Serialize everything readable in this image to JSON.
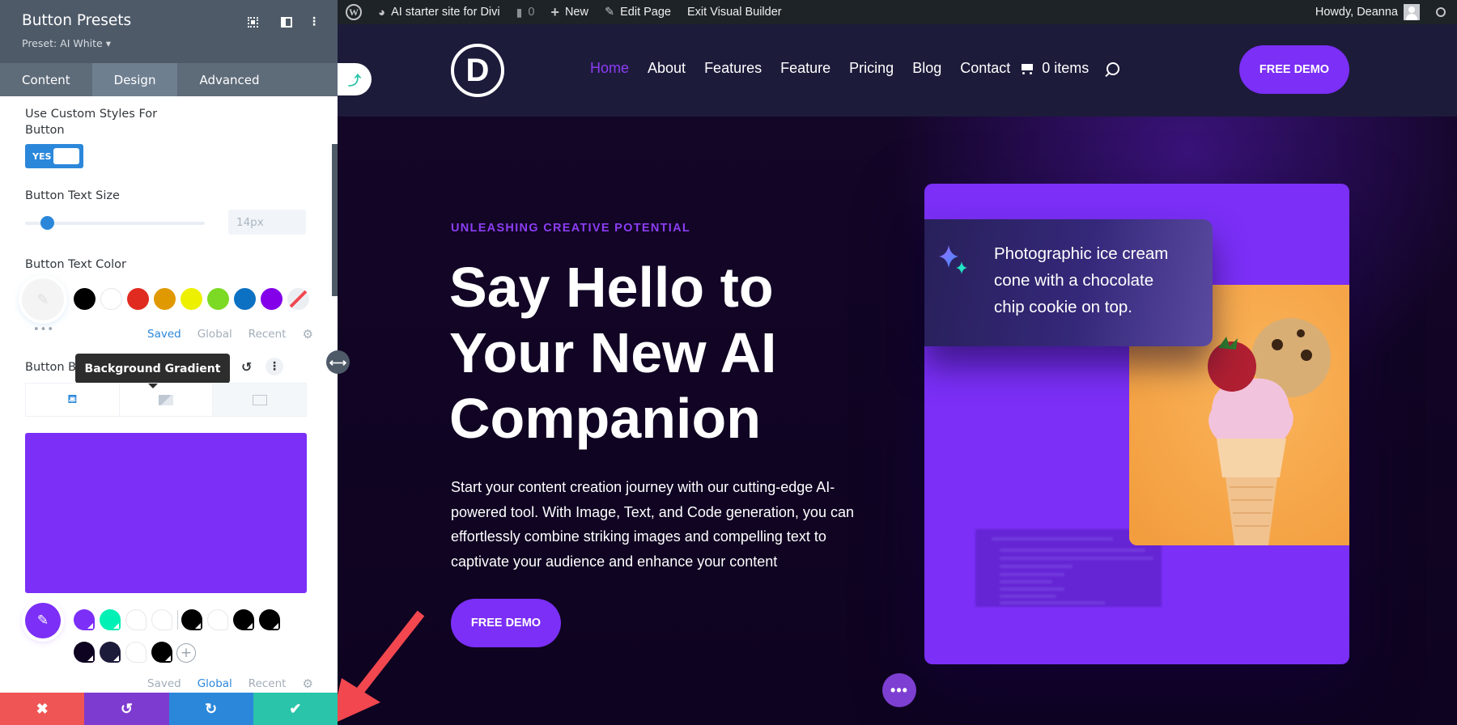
{
  "admin_bar": {
    "site_name": "AI starter site for Divi",
    "comments_count": "0",
    "new_label": "New",
    "edit_page_label": "Edit Page",
    "exit_builder_label": "Exit Visual Builder",
    "greeting": "Howdy, Deanna"
  },
  "site_header": {
    "logo_letter": "D",
    "nav": [
      {
        "label": "Home",
        "active": true
      },
      {
        "label": "About"
      },
      {
        "label": "Features"
      },
      {
        "label": "Feature"
      },
      {
        "label": "Pricing"
      },
      {
        "label": "Blog"
      },
      {
        "label": "Contact"
      }
    ],
    "cart_label": "0 items",
    "cta_label": "FREE DEMO"
  },
  "hero": {
    "eyebrow": "UNLEASHING CREATIVE POTENTIAL",
    "title_lines": [
      "Say Hello to",
      "Your New AI",
      "Companion"
    ],
    "paragraph_lines": [
      "Start your content creation journey with our cutting-edge AI-",
      "powered tool. With Image, Text, and Code generation, you can",
      "effortlessly combine striking images and compelling text to",
      "captivate your audience and enhance your content"
    ],
    "cta_label": "FREE DEMO",
    "prompt_lines": [
      "Photographic ice cream",
      "cone with a chocolate",
      "chip cookie on top."
    ],
    "more_button_label": "•••"
  },
  "panel": {
    "title": "Button Presets",
    "preset_label": "Preset: AI White ▾",
    "tabs": [
      {
        "label": "Content"
      },
      {
        "label": "Design",
        "active": true
      },
      {
        "label": "Advanced"
      }
    ],
    "custom_styles_label_line1": "Use Custom Styles For",
    "custom_styles_label_line2": "Button",
    "toggle_label": "YES",
    "toggle_on": true,
    "text_size_label": "Button Text Size",
    "text_size_value": "14px",
    "text_size_slider_fraction": 0.12,
    "text_color_label": "Button Text Color",
    "text_color_swatches": [
      "#000000",
      "#ffffff",
      "#e02b20",
      "#e09900",
      "#edf000",
      "#7cda24",
      "#0c71c3",
      "#8300e9",
      "none"
    ],
    "picker_more": "•••",
    "palette_tabs_1": [
      {
        "label": "Saved",
        "active": true
      },
      {
        "label": "Global"
      },
      {
        "label": "Recent"
      }
    ],
    "bg_label": "Button Background",
    "tooltip": "Background Gradient",
    "bg_color": "#7b2ff7",
    "global_swatches_row1": [
      "#7b2ff7",
      "#00f0b5",
      "#ffffff",
      "#ffffff",
      "#000000",
      "#ffffff",
      "#000000",
      "#000000"
    ],
    "global_swatches_row2": [
      "#0e0320",
      "#1d1b3a",
      "#ffffff",
      "#000000"
    ],
    "palette_tabs_2": [
      {
        "label": "Saved"
      },
      {
        "label": "Global",
        "active": true
      },
      {
        "label": "Recent"
      }
    ],
    "bottom_bar": [
      {
        "name": "discard",
        "glyph": "✖",
        "color": "#ef5555"
      },
      {
        "name": "undo",
        "glyph": "↺",
        "color": "#7e3bd0"
      },
      {
        "name": "redo",
        "glyph": "↻",
        "color": "#2b87da"
      },
      {
        "name": "save",
        "glyph": "✔",
        "color": "#29c4a9"
      }
    ]
  },
  "colors": {
    "accent": "#7b2ff7",
    "divi_blue": "#2b87da",
    "panel_header": "#4e5a68",
    "annotation_arrow": "#f2474f"
  }
}
